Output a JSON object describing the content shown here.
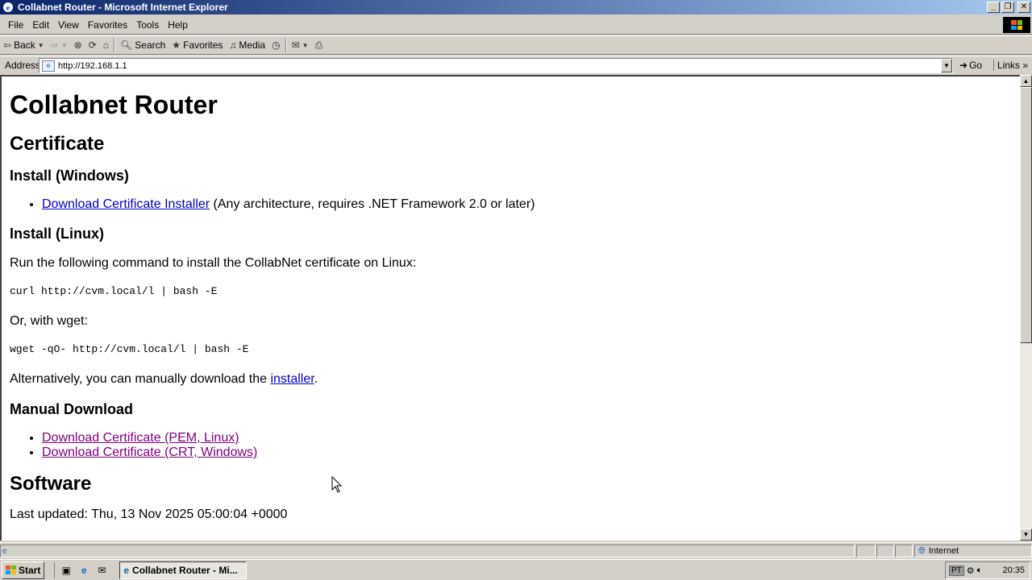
{
  "window": {
    "title": "Collabnet Router - Microsoft Internet Explorer",
    "controls": [
      "minimize",
      "restore",
      "close"
    ]
  },
  "menubar": {
    "items": [
      "File",
      "Edit",
      "View",
      "Favorites",
      "Tools",
      "Help"
    ]
  },
  "toolbar": {
    "back_label": "Back",
    "search_label": "Search",
    "favorites_label": "Favorites",
    "media_label": "Media"
  },
  "addressbar": {
    "label": "Address",
    "url": "http://192.168.1.1",
    "go_label": "Go",
    "links_label": "Links"
  },
  "page": {
    "h1": "Collabnet Router",
    "certificate": {
      "heading": "Certificate",
      "windows": {
        "heading": "Install (Windows)",
        "link": "Download Certificate Installer",
        "note": " (Any architecture, requires .NET Framework 2.0 or later)"
      },
      "linux": {
        "heading": "Install (Linux)",
        "intro": "Run the following command to install the CollabNet certificate on Linux:",
        "curl_cmd": "curl http://cvm.local/l | bash -E",
        "or_wget": "Or, with wget:",
        "wget_cmd": "wget -qO- http://cvm.local/l | bash -E",
        "alt_prefix": "Alternatively, you can manually download the ",
        "alt_link": "installer",
        "alt_suffix": "."
      },
      "manual": {
        "heading": "Manual Download",
        "links": [
          "Download Certificate (PEM, Linux)",
          "Download Certificate (CRT, Windows)"
        ]
      }
    },
    "software": {
      "heading": "Software",
      "last_updated": "Last updated: Thu, 13 Nov 2025 05:00:04 +0000"
    }
  },
  "statusbar": {
    "zone": "Internet"
  },
  "taskbar": {
    "start_label": "Start",
    "task_label": "Collabnet Router - Mi...",
    "lang": "PT",
    "clock": "20:35"
  }
}
